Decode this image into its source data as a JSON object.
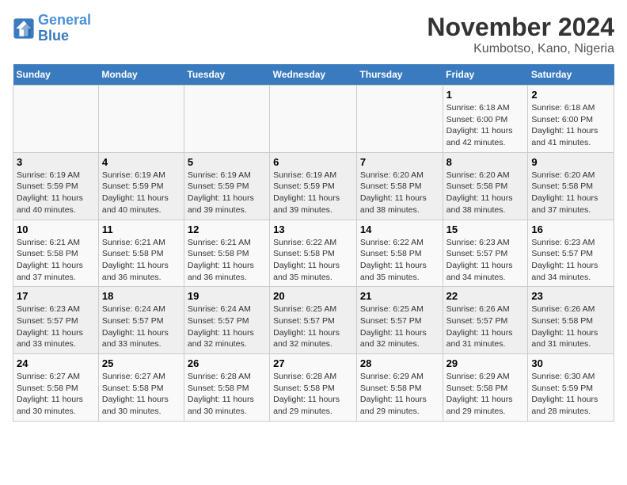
{
  "logo": {
    "line1": "General",
    "line2": "Blue"
  },
  "title": "November 2024",
  "subtitle": "Kumbotso, Kano, Nigeria",
  "days_of_week": [
    "Sunday",
    "Monday",
    "Tuesday",
    "Wednesday",
    "Thursday",
    "Friday",
    "Saturday"
  ],
  "weeks": [
    [
      {
        "day": "",
        "info": ""
      },
      {
        "day": "",
        "info": ""
      },
      {
        "day": "",
        "info": ""
      },
      {
        "day": "",
        "info": ""
      },
      {
        "day": "",
        "info": ""
      },
      {
        "day": "1",
        "info": "Sunrise: 6:18 AM\nSunset: 6:00 PM\nDaylight: 11 hours and 42 minutes."
      },
      {
        "day": "2",
        "info": "Sunrise: 6:18 AM\nSunset: 6:00 PM\nDaylight: 11 hours and 41 minutes."
      }
    ],
    [
      {
        "day": "3",
        "info": "Sunrise: 6:19 AM\nSunset: 5:59 PM\nDaylight: 11 hours and 40 minutes."
      },
      {
        "day": "4",
        "info": "Sunrise: 6:19 AM\nSunset: 5:59 PM\nDaylight: 11 hours and 40 minutes."
      },
      {
        "day": "5",
        "info": "Sunrise: 6:19 AM\nSunset: 5:59 PM\nDaylight: 11 hours and 39 minutes."
      },
      {
        "day": "6",
        "info": "Sunrise: 6:19 AM\nSunset: 5:59 PM\nDaylight: 11 hours and 39 minutes."
      },
      {
        "day": "7",
        "info": "Sunrise: 6:20 AM\nSunset: 5:58 PM\nDaylight: 11 hours and 38 minutes."
      },
      {
        "day": "8",
        "info": "Sunrise: 6:20 AM\nSunset: 5:58 PM\nDaylight: 11 hours and 38 minutes."
      },
      {
        "day": "9",
        "info": "Sunrise: 6:20 AM\nSunset: 5:58 PM\nDaylight: 11 hours and 37 minutes."
      }
    ],
    [
      {
        "day": "10",
        "info": "Sunrise: 6:21 AM\nSunset: 5:58 PM\nDaylight: 11 hours and 37 minutes."
      },
      {
        "day": "11",
        "info": "Sunrise: 6:21 AM\nSunset: 5:58 PM\nDaylight: 11 hours and 36 minutes."
      },
      {
        "day": "12",
        "info": "Sunrise: 6:21 AM\nSunset: 5:58 PM\nDaylight: 11 hours and 36 minutes."
      },
      {
        "day": "13",
        "info": "Sunrise: 6:22 AM\nSunset: 5:58 PM\nDaylight: 11 hours and 35 minutes."
      },
      {
        "day": "14",
        "info": "Sunrise: 6:22 AM\nSunset: 5:58 PM\nDaylight: 11 hours and 35 minutes."
      },
      {
        "day": "15",
        "info": "Sunrise: 6:23 AM\nSunset: 5:57 PM\nDaylight: 11 hours and 34 minutes."
      },
      {
        "day": "16",
        "info": "Sunrise: 6:23 AM\nSunset: 5:57 PM\nDaylight: 11 hours and 34 minutes."
      }
    ],
    [
      {
        "day": "17",
        "info": "Sunrise: 6:23 AM\nSunset: 5:57 PM\nDaylight: 11 hours and 33 minutes."
      },
      {
        "day": "18",
        "info": "Sunrise: 6:24 AM\nSunset: 5:57 PM\nDaylight: 11 hours and 33 minutes."
      },
      {
        "day": "19",
        "info": "Sunrise: 6:24 AM\nSunset: 5:57 PM\nDaylight: 11 hours and 32 minutes."
      },
      {
        "day": "20",
        "info": "Sunrise: 6:25 AM\nSunset: 5:57 PM\nDaylight: 11 hours and 32 minutes."
      },
      {
        "day": "21",
        "info": "Sunrise: 6:25 AM\nSunset: 5:57 PM\nDaylight: 11 hours and 32 minutes."
      },
      {
        "day": "22",
        "info": "Sunrise: 6:26 AM\nSunset: 5:57 PM\nDaylight: 11 hours and 31 minutes."
      },
      {
        "day": "23",
        "info": "Sunrise: 6:26 AM\nSunset: 5:58 PM\nDaylight: 11 hours and 31 minutes."
      }
    ],
    [
      {
        "day": "24",
        "info": "Sunrise: 6:27 AM\nSunset: 5:58 PM\nDaylight: 11 hours and 30 minutes."
      },
      {
        "day": "25",
        "info": "Sunrise: 6:27 AM\nSunset: 5:58 PM\nDaylight: 11 hours and 30 minutes."
      },
      {
        "day": "26",
        "info": "Sunrise: 6:28 AM\nSunset: 5:58 PM\nDaylight: 11 hours and 30 minutes."
      },
      {
        "day": "27",
        "info": "Sunrise: 6:28 AM\nSunset: 5:58 PM\nDaylight: 11 hours and 29 minutes."
      },
      {
        "day": "28",
        "info": "Sunrise: 6:29 AM\nSunset: 5:58 PM\nDaylight: 11 hours and 29 minutes."
      },
      {
        "day": "29",
        "info": "Sunrise: 6:29 AM\nSunset: 5:58 PM\nDaylight: 11 hours and 29 minutes."
      },
      {
        "day": "30",
        "info": "Sunrise: 6:30 AM\nSunset: 5:59 PM\nDaylight: 11 hours and 28 minutes."
      }
    ]
  ]
}
